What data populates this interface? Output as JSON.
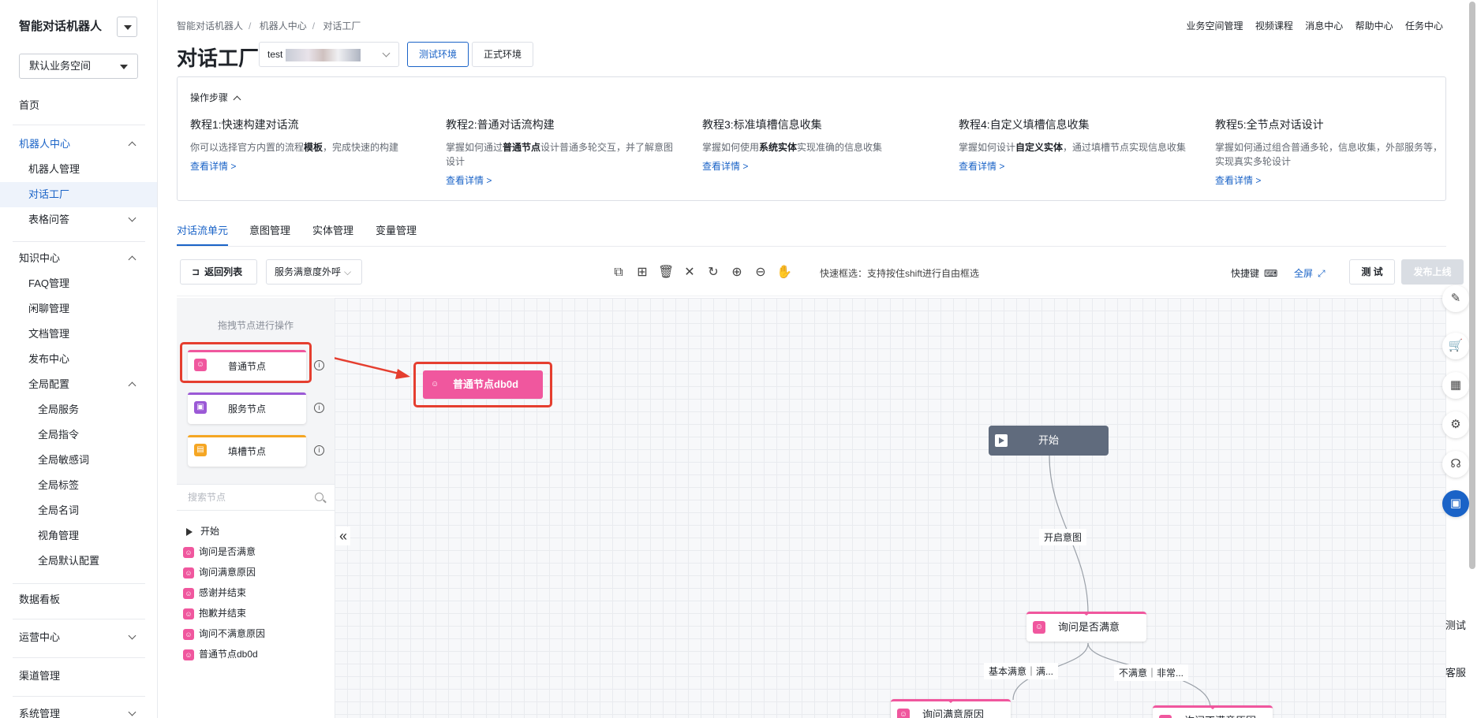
{
  "sidebar": {
    "brand": "智能对话机器人",
    "workspace": "默认业务空间",
    "items": [
      {
        "label": "首页"
      },
      {
        "label": "机器人中心"
      },
      {
        "label": "机器人管理"
      },
      {
        "label": "对话工厂"
      },
      {
        "label": "表格问答"
      },
      {
        "label": "知识中心"
      },
      {
        "label": "FAQ管理"
      },
      {
        "label": "闲聊管理"
      },
      {
        "label": "文档管理"
      },
      {
        "label": "发布中心"
      },
      {
        "label": "全局配置"
      },
      {
        "label": "全局服务"
      },
      {
        "label": "全局指令"
      },
      {
        "label": "全局敏感词"
      },
      {
        "label": "全局标签"
      },
      {
        "label": "全局名词"
      },
      {
        "label": "视角管理"
      },
      {
        "label": "全局默认配置"
      },
      {
        "label": "数据看板"
      },
      {
        "label": "运营中心"
      },
      {
        "label": "渠道管理"
      },
      {
        "label": "系统管理"
      }
    ]
  },
  "header": {
    "breadcrumb": [
      "智能对话机器人",
      "机器人中心",
      "对话工厂"
    ],
    "top_links": [
      "业务空间管理",
      "视频课程",
      "消息中心",
      "帮助中心",
      "任务中心"
    ],
    "title": "对话工厂",
    "bot_name": "test",
    "env_test": "测试环境",
    "env_prod": "正式环境"
  },
  "steps": {
    "header": "操作步骤",
    "items": [
      {
        "title": "教程1:快速构建对话流",
        "desc_pre": "你可以选择官方内置的流程",
        "desc_bold": "模板",
        "desc_post": "，完成快速的构建",
        "link": "查看详情 >"
      },
      {
        "title": "教程2:普通对话流构建",
        "desc_pre": "掌握如何通过",
        "desc_bold": "普通节点",
        "desc_post": "设计普通多轮交互，并了解意图设计",
        "link": "查看详情 >"
      },
      {
        "title": "教程3:标准填槽信息收集",
        "desc_pre": "掌握如何使用",
        "desc_bold": "系统实体",
        "desc_post": "实现准确的信息收集",
        "link": "查看详情 >"
      },
      {
        "title": "教程4:自定义填槽信息收集",
        "desc_pre": "掌握如何设计",
        "desc_bold": "自定义实体",
        "desc_post": "，通过填槽节点实现信息收集",
        "link": "查看详情 >"
      },
      {
        "title": "教程5:全节点对话设计",
        "desc_pre": "掌握如何通过组合普通多轮，信息收集，外部服务等，实现真实多轮设计",
        "desc_bold": "",
        "desc_post": "",
        "link": "查看详情 >"
      }
    ]
  },
  "tabs": [
    "对话流单元",
    "意图管理",
    "实体管理",
    "变量管理"
  ],
  "toolbar": {
    "back": "返回列表",
    "flow_select": "服务满意度外呼",
    "hint": "快速框选：支持按住shift进行自由框选",
    "shortcut": "快捷键",
    "fullscreen": "全屏",
    "test": "测 试",
    "publish": "发布上线"
  },
  "palette": {
    "hint": "拖拽节点进行操作",
    "nodes": [
      {
        "label": "普通节点",
        "color": "#f0579e"
      },
      {
        "label": "服务节点",
        "color": "#9b59d6"
      },
      {
        "label": "填槽节点",
        "color": "#f5a623"
      }
    ],
    "search_placeholder": "搜索节点",
    "tree": [
      "开始",
      "询问是否满意",
      "询问满意原因",
      "感谢并结束",
      "抱歉并结束",
      "询问不满意原因",
      "普通节点db0d"
    ]
  },
  "canvas": {
    "start": "开始",
    "dragged_node": "普通节点db0d",
    "edge_open": "开启意图",
    "node_ask": "询问是否满意",
    "edge_satisfied": "基本满意｜满...",
    "edge_unsatisfied": "不满意｜非常...",
    "node_reason": "询问满意原因",
    "node_unsat_reason": "询问不满意原因"
  },
  "float_bar": {
    "test": "测试",
    "service": "客服"
  },
  "colors": {
    "accent": "#1a63c7",
    "normal_node": "#f0579e",
    "service_node": "#9b59d6",
    "slot_node": "#f5a623",
    "highlight": "#e53e2f"
  }
}
